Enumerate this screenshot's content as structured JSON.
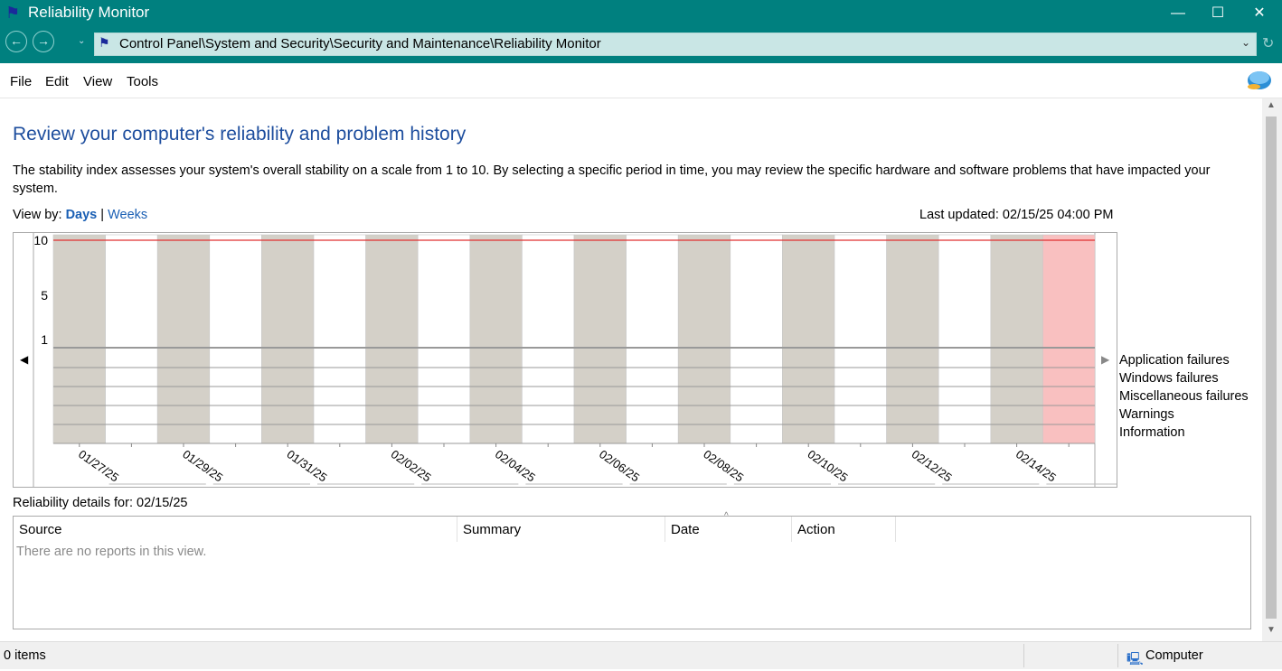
{
  "window": {
    "title": "Reliability Monitor",
    "minimize": "—",
    "maximize": "☐",
    "close": "✕"
  },
  "nav": {
    "back": "←",
    "forward": "→",
    "history": "⌄",
    "refresh": "↻"
  },
  "address": {
    "path": "Control Panel\\System and Security\\Security and Maintenance\\Reliability Monitor",
    "chevron": "⌄"
  },
  "menu": {
    "file": "File",
    "edit": "Edit",
    "view": "View",
    "tools": "Tools"
  },
  "page": {
    "heading": "Review your computer's reliability and problem history",
    "description": "The stability index assesses your system's overall stability on a scale from 1 to 10. By selecting a specific period in time, you may review the specific hardware and software problems that have impacted your system.",
    "view_by_label": "View by:",
    "view_days": "Days",
    "view_sep": "|",
    "view_weeks": "Weeks",
    "last_updated": "Last updated: 02/15/25 04:00 PM"
  },
  "chart_data": {
    "type": "line",
    "y_ticks": [
      "10",
      "5",
      "1"
    ],
    "ylim": [
      1,
      10
    ],
    "columns": 20,
    "selected_column": 20,
    "stability_value": 10,
    "date_labels": [
      "01/27/25",
      "01/29/25",
      "01/31/25",
      "02/02/25",
      "02/04/25",
      "02/06/25",
      "02/08/25",
      "02/10/25",
      "02/12/25",
      "02/14/25"
    ],
    "rows": [
      "Application failures",
      "Windows failures",
      "Miscellaneous failures",
      "Warnings",
      "Information"
    ],
    "colors": {
      "shaded": "#d4d0c8",
      "selected": "#f9c0c0",
      "line": "#e03030",
      "grid": "#999999"
    }
  },
  "details": {
    "label": "Reliability details for: 02/15/25",
    "columns": [
      "Source",
      "Summary",
      "Date",
      "Action"
    ],
    "empty_text": "There are no reports in this view."
  },
  "status": {
    "items": "0 items",
    "zone": "Computer"
  }
}
